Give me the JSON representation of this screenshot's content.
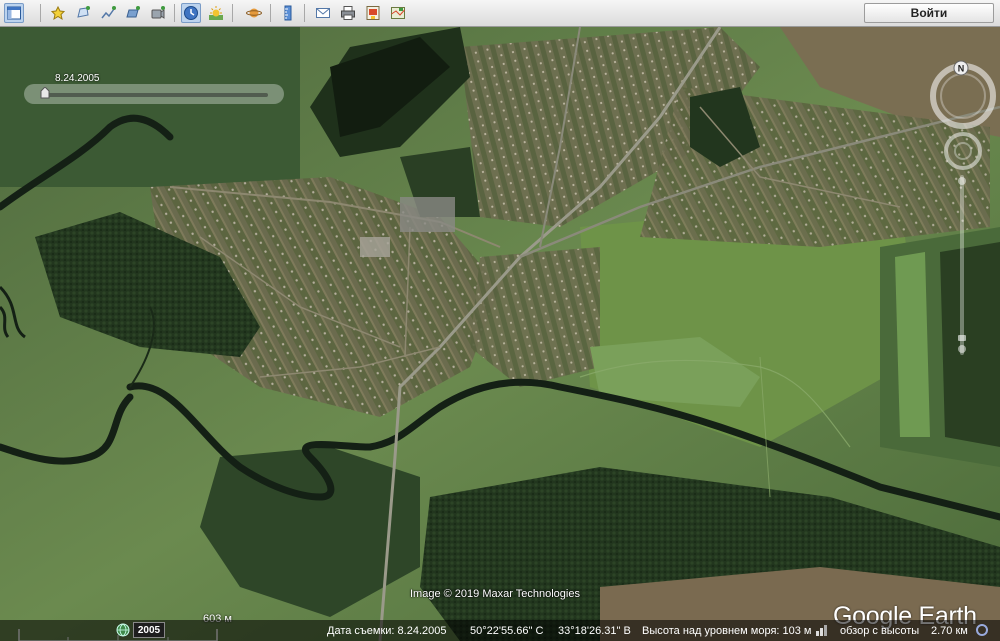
{
  "toolbar": {
    "buttons": [
      {
        "name": "sidebar-toggle-button",
        "icon": "sidebar-icon",
        "active": true
      },
      {
        "name": "add-placemark-button",
        "icon": "placemark-icon",
        "active": false
      },
      {
        "name": "add-polygon-button",
        "icon": "polygon-icon",
        "active": false
      },
      {
        "name": "add-path-button",
        "icon": "path-icon",
        "active": false
      },
      {
        "name": "image-overlay-button",
        "icon": "image-overlay-icon",
        "active": false
      },
      {
        "name": "record-tour-button",
        "icon": "record-tour-icon",
        "active": false
      },
      {
        "name": "historical-imagery-button",
        "icon": "clock-icon",
        "active": true
      },
      {
        "name": "sunlight-button",
        "icon": "sun-icon",
        "active": false
      },
      {
        "name": "planets-button",
        "icon": "planet-icon",
        "active": false
      },
      {
        "name": "ruler-button",
        "icon": "ruler-icon",
        "active": false
      },
      {
        "name": "email-button",
        "icon": "email-icon",
        "active": false
      },
      {
        "name": "print-button",
        "icon": "print-icon",
        "active": false
      },
      {
        "name": "save-image-button",
        "icon": "save-image-icon",
        "active": false
      },
      {
        "name": "view-in-maps-button",
        "icon": "map-view-icon",
        "active": false
      }
    ],
    "signin_label": "Войти"
  },
  "time_slider": {
    "date": "8.24.2005",
    "position": 0.0
  },
  "compass": {
    "north_label": "N"
  },
  "map": {
    "attribution": "Image © 2019 Maxar Technologies",
    "logo": "Google Earth",
    "scale_label": "603 м"
  },
  "status": {
    "year": "2005",
    "capture_date": "Дата съемки: 8.24.2005",
    "lat": "50°22'55.66\" С",
    "lon": "33°18'26.31\" В",
    "elevation": "Высота над уровнем моря:  103 м",
    "eye_alt": "обзор с высоты",
    "eye_alt_value": "2.70 км"
  },
  "colors": {
    "field_green": "#6b8a4f",
    "forest": "#22361e",
    "river": "#142015",
    "road": "#9a9a8a",
    "village": "#7a6e55"
  }
}
